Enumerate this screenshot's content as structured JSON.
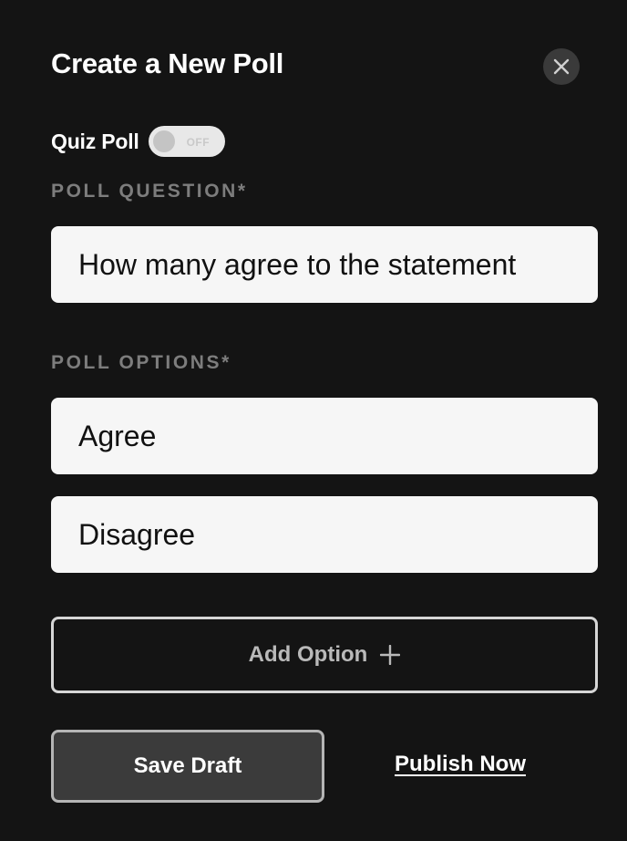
{
  "modal": {
    "title": "Create a New Poll",
    "close_icon": "close-icon"
  },
  "quiz_poll": {
    "label": "Quiz Poll",
    "toggle_state": "OFF",
    "enabled": false
  },
  "question": {
    "label": "POLL QUESTION*",
    "value": "How many agree to the statement"
  },
  "options": {
    "label": "POLL OPTIONS*",
    "items": [
      {
        "value": "Agree"
      },
      {
        "value": "Disagree"
      }
    ],
    "add_label": "Add Option",
    "add_icon": "plus-icon"
  },
  "actions": {
    "save_draft": "Save Draft",
    "publish_now": "Publish Now"
  },
  "colors": {
    "background": "#141414",
    "field_background": "#f6f6f6",
    "label_gray": "#7d7d7d",
    "button_dark": "#3b3b3b"
  }
}
